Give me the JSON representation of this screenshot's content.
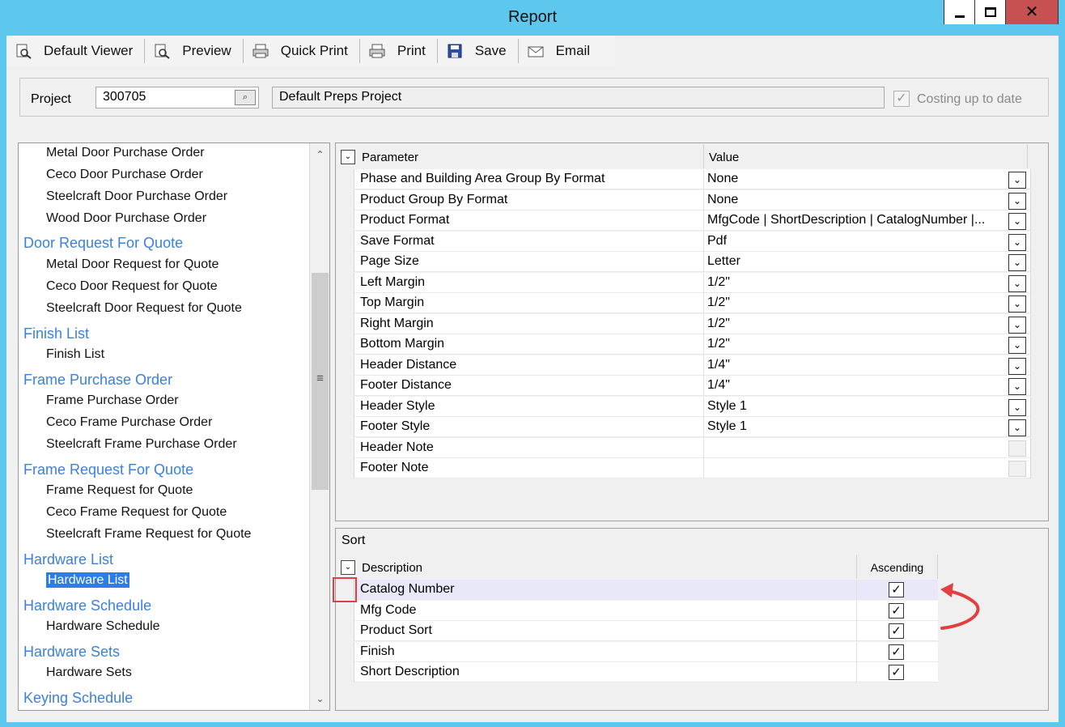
{
  "window": {
    "title": "Report"
  },
  "toolbar": {
    "items": [
      {
        "label": "Default Viewer",
        "icon": "magnifier-page-icon"
      },
      {
        "label": "Preview",
        "icon": "magnifier-page-icon"
      },
      {
        "label": "Quick Print",
        "icon": "printer-icon"
      },
      {
        "label": "Print",
        "icon": "printer-icon"
      },
      {
        "label": "Save",
        "icon": "floppy-disk-icon"
      },
      {
        "label": "Email",
        "icon": "envelope-icon"
      }
    ]
  },
  "project": {
    "label": "Project",
    "number": "300705",
    "description": "Default Preps Project",
    "costing_label": "Costing up to date",
    "costing_checked": true
  },
  "tree": {
    "items": [
      {
        "text": "Metal Door Purchase Order",
        "level": "child"
      },
      {
        "text": "Ceco Door Purchase Order",
        "level": "child"
      },
      {
        "text": "Steelcraft Door Purchase Order",
        "level": "child"
      },
      {
        "text": "Wood Door Purchase Order",
        "level": "child"
      },
      {
        "text": "Door Request For Quote",
        "level": "group"
      },
      {
        "text": "Metal Door Request for Quote",
        "level": "child"
      },
      {
        "text": "Ceco Door Request for Quote",
        "level": "child"
      },
      {
        "text": "Steelcraft Door Request for Quote",
        "level": "child"
      },
      {
        "text": "Finish List",
        "level": "group"
      },
      {
        "text": "Finish List",
        "level": "child"
      },
      {
        "text": "Frame Purchase Order",
        "level": "group"
      },
      {
        "text": "Frame Purchase Order",
        "level": "child"
      },
      {
        "text": "Ceco Frame Purchase Order",
        "level": "child"
      },
      {
        "text": "Steelcraft Frame Purchase Order",
        "level": "child"
      },
      {
        "text": "Frame Request For Quote",
        "level": "group"
      },
      {
        "text": "Frame Request for Quote",
        "level": "child"
      },
      {
        "text": "Ceco Frame Request for Quote",
        "level": "child"
      },
      {
        "text": "Steelcraft Frame Request for Quote",
        "level": "child"
      },
      {
        "text": "Hardware List",
        "level": "group"
      },
      {
        "text": "Hardware List",
        "level": "child",
        "selected": true
      },
      {
        "text": "Hardware Schedule",
        "level": "group"
      },
      {
        "text": "Hardware Schedule",
        "level": "child"
      },
      {
        "text": "Hardware Sets",
        "level": "group"
      },
      {
        "text": "Hardware Sets",
        "level": "child"
      },
      {
        "text": "Keying Schedule",
        "level": "group"
      }
    ]
  },
  "parameters": {
    "col_parameter": "Parameter",
    "col_value": "Value",
    "rows": [
      {
        "name": "Phase and Building Area Group By Format",
        "value": "None",
        "dropdown": true
      },
      {
        "name": "Product Group By Format",
        "value": "None",
        "dropdown": true
      },
      {
        "name": "Product Format",
        "value": "MfgCode | ShortDescription | CatalogNumber |...",
        "dropdown": true
      },
      {
        "name": "Save Format",
        "value": "Pdf",
        "dropdown": true
      },
      {
        "name": "Page Size",
        "value": "Letter",
        "dropdown": true
      },
      {
        "name": "Left Margin",
        "value": "1/2\"",
        "dropdown": true
      },
      {
        "name": "Top Margin",
        "value": "1/2\"",
        "dropdown": true
      },
      {
        "name": "Right Margin",
        "value": "1/2\"",
        "dropdown": true
      },
      {
        "name": "Bottom Margin",
        "value": "1/2\"",
        "dropdown": true
      },
      {
        "name": "Header Distance",
        "value": "1/4\"",
        "dropdown": true
      },
      {
        "name": "Footer Distance",
        "value": "1/4\"",
        "dropdown": true
      },
      {
        "name": "Header Style",
        "value": "Style 1",
        "dropdown": true
      },
      {
        "name": "Footer Style",
        "value": "Style 1",
        "dropdown": true
      },
      {
        "name": "Header Note",
        "value": "",
        "dropdown": false
      },
      {
        "name": "Footer Note",
        "value": "",
        "dropdown": false
      }
    ]
  },
  "sort": {
    "title": "Sort",
    "col_description": "Description",
    "col_ascending": "Ascending",
    "rows": [
      {
        "description": "Catalog Number",
        "ascending": true
      },
      {
        "description": "Mfg Code",
        "ascending": true
      },
      {
        "description": "Product Sort",
        "ascending": true
      },
      {
        "description": "Finish",
        "ascending": true
      },
      {
        "description": "Short Description",
        "ascending": true
      }
    ]
  },
  "colors": {
    "titlebar": "#5ec7ed",
    "tree_group": "#3b7fe0",
    "selection": "#2b7de9",
    "annotation": "#e04040"
  }
}
